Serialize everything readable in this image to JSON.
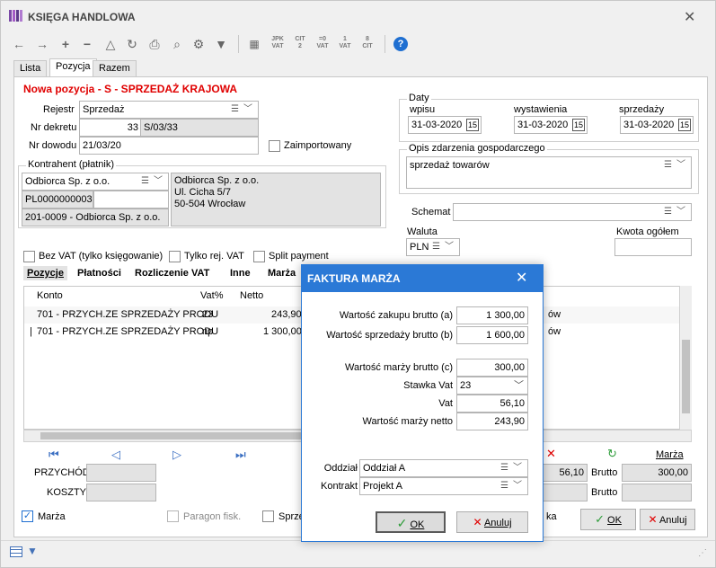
{
  "window": {
    "title": "KSIĘGA HANDLOWA"
  },
  "tabs": [
    {
      "label": "Lista"
    },
    {
      "label": "Pozycja"
    },
    {
      "label": "Razem"
    }
  ],
  "toolbar": {
    "jpk_vat": "JPK\nVAT",
    "cit2": "CIT\n2",
    "vat_eq": "=0\nVAT",
    "vat1": "1\nVAT",
    "cit": "8\nCIT"
  },
  "header": {
    "title": "Nowa pozycja - S - SPRZEDAŻ KRAJOWA"
  },
  "form": {
    "rejestr_label": "Rejestr",
    "rejestr_value": "Sprzedaż",
    "nr_dekretu_label": "Nr dekretu",
    "nr_dekretu_num": "33",
    "nr_dekretu_value": "S/03/33",
    "nr_dowodu_label": "Nr dowodu",
    "nr_dowodu_value": "21/03/20",
    "zaimportowany_label": "Zaimportowany"
  },
  "kontrahent": {
    "group_label": "Kontrahent (płatnik)",
    "name": "Odbiorca Sp. z o.o.",
    "nip": "PL0000000003",
    "account": "201-0009 - Odbiorca Sp. z o.o.",
    "address_line1": "Odbiorca Sp. z o.o.",
    "address_line2": "Ul. Cicha 5/7",
    "address_line3": "50-504 Wrocław"
  },
  "daty": {
    "group_label": "Daty",
    "wpisu_label": "wpisu",
    "wpisu_value": "31-03-2020",
    "wystawienia_label": "wystawienia",
    "wystawienia_value": "31-03-2020",
    "sprzedazy_label": "sprzedaży",
    "sprzedazy_value": "31-03-2020"
  },
  "opis": {
    "group_label": "Opis zdarzenia gospodarczego",
    "value": "sprzedaż towarów"
  },
  "schemat_label": "Schemat",
  "waluta": {
    "label": "Waluta",
    "value": "PLN"
  },
  "kwota_label": "Kwota ogółem",
  "checkboxes": {
    "bez_vat": "Bez VAT (tylko księgowanie)",
    "tylko_rej": "Tylko rej. VAT",
    "split": "Split payment"
  },
  "subtabs": [
    {
      "label": "Pozycje"
    },
    {
      "label": "Płatności"
    },
    {
      "label": "Rozliczenie VAT"
    },
    {
      "label": "Inne"
    },
    {
      "label": "Marża"
    }
  ],
  "grid": {
    "columns": [
      "Konto",
      "Vat%",
      "Netto"
    ],
    "rows": [
      {
        "konto": "701 - PRZYCH.ZE SPRZEDAŻY PRODU",
        "vat": "23",
        "netto": "243,90",
        "tail": "ów"
      },
      {
        "konto": "701 - PRZYCH.ZE SPRZEDAŻY PRODU",
        "vat": "np",
        "netto": "1 300,00",
        "tail": "ów"
      }
    ]
  },
  "bottom": {
    "przychod_label": "PRZYCHÓD",
    "koszty_label": "KOSZTY",
    "marza_label": "Marża",
    "netto_value": "56,10",
    "brutto_label": "Brutto",
    "brutto_value": "300,00",
    "brutto2_label": "Brutto",
    "marza_check": "Marża",
    "paragon": "Paragon fisk.",
    "sprzed": "Sprze",
    "tail": "ka",
    "ok": "OK",
    "anuluj": "Anuluj"
  },
  "dialog": {
    "title": "FAKTURA MARŻA",
    "zakup_label": "Wartość zakupu brutto (a)",
    "zakup_value": "1 300,00",
    "sprzedaz_label": "Wartość sprzedaży brutto (b)",
    "sprzedaz_value": "1 600,00",
    "marza_brutto_label": "Wartość marży brutto (c)",
    "marza_brutto_value": "300,00",
    "stawka_label": "Stawka Vat",
    "stawka_value": "23",
    "vat_label": "Vat",
    "vat_value": "56,10",
    "marza_netto_label": "Wartość marży netto",
    "marza_netto_value": "243,90",
    "oddzial_label": "Oddział",
    "oddzial_value": "Oddział A",
    "kontrakt_label": "Kontrakt",
    "kontrakt_value": "Projekt A",
    "ok": "OK",
    "anuluj": "Anuluj"
  },
  "colors": {
    "accent": "#2b79d6",
    "red": "#e00000",
    "ok_green": "#2e9d3a"
  }
}
